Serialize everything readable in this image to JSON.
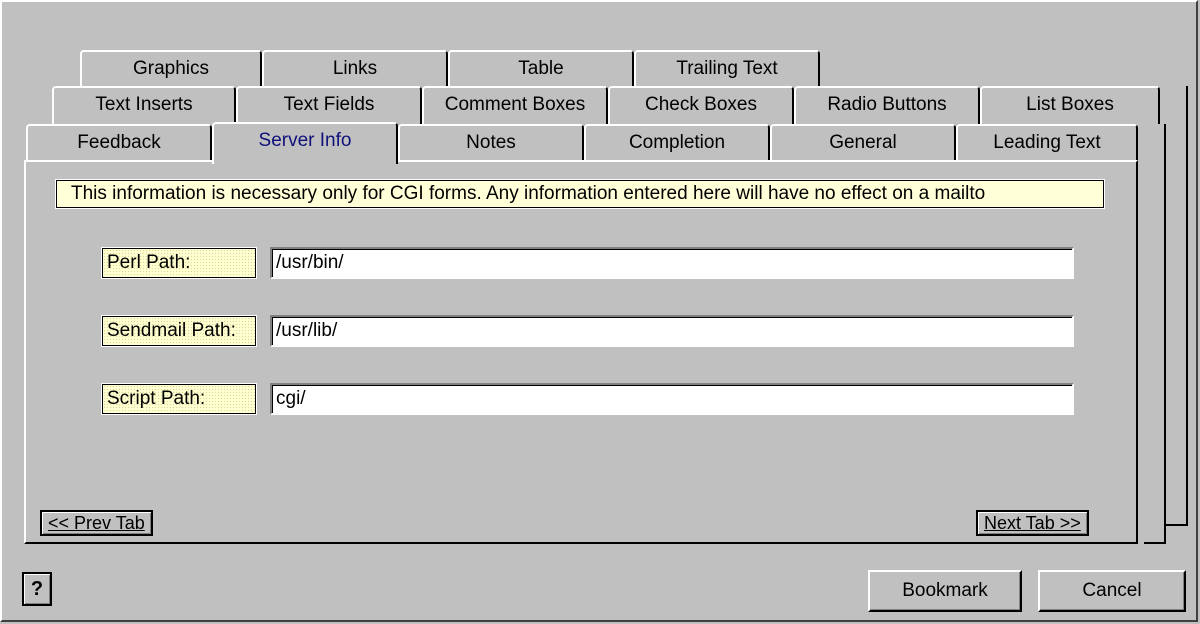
{
  "tabs": {
    "row1": [
      "Graphics",
      "Links",
      "Table",
      "Trailing Text"
    ],
    "row2": [
      "Text Inserts",
      "Text Fields",
      "Comment Boxes",
      "Check Boxes",
      "Radio Buttons",
      "List Boxes"
    ],
    "row3": [
      "Feedback",
      "Server Info",
      "Notes",
      "Completion",
      "General",
      "Leading Text"
    ],
    "active": "Server Info"
  },
  "info_text": "This information is necessary only for CGI forms.  Any information entered here will have no effect on a mailto",
  "fields": [
    {
      "label": "Perl Path:",
      "value": "/usr/bin/"
    },
    {
      "label": "Sendmail Path:",
      "value": "/usr/lib/"
    },
    {
      "label": "Script Path:",
      "value": "cgi/"
    }
  ],
  "nav": {
    "prev": "<< Prev Tab",
    "next": "Next Tab >>"
  },
  "buttons": {
    "help": "?",
    "bookmark": "Bookmark",
    "cancel": "Cancel"
  }
}
